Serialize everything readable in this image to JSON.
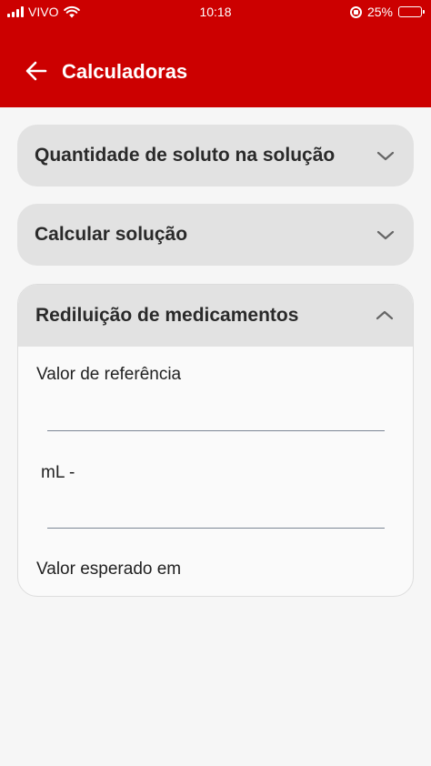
{
  "status_bar": {
    "carrier": "VIVO",
    "time": "10:18",
    "battery": "25%",
    "battery_level": 0.25
  },
  "header": {
    "title": "Calculadoras",
    "back_icon": "arrow-left-icon"
  },
  "accordion": [
    {
      "title": "Quantidade de soluto na solução",
      "expanded": false
    },
    {
      "title": "Calcular solução",
      "expanded": false
    },
    {
      "title": "Rediluição de medicamentos",
      "expanded": true
    }
  ],
  "rediluicao": {
    "reference_label": "Valor de referência",
    "reference_value": "",
    "ml_label": "mL -",
    "ml_value": "",
    "expected_label": "Valor esperado em"
  },
  "colors": {
    "header": "#cc0000",
    "card": "#e2e2e2",
    "background": "#f6f6f6",
    "battery": "#f5c400"
  }
}
